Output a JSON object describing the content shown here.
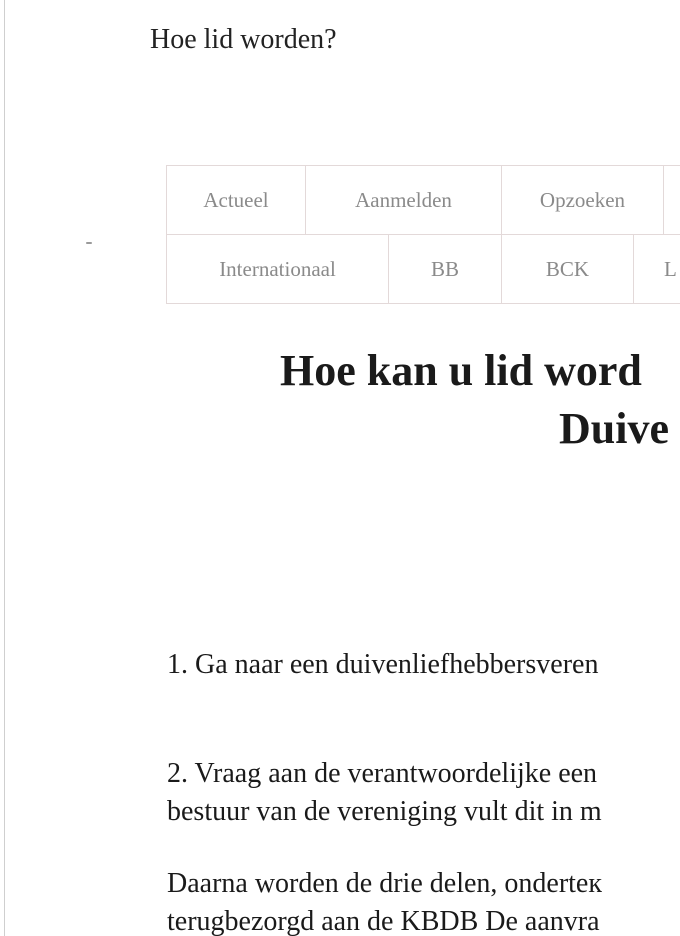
{
  "header": {
    "title": "Hoe lid worden?"
  },
  "nav": {
    "row1": [
      "Actueel",
      "Aanmelden",
      "Opzoeken",
      ""
    ],
    "row2": [
      "Internationaal",
      "BB",
      "BCK",
      "L"
    ]
  },
  "main": {
    "title_line1": "Hoe kan u lid word",
    "title_line2": "Duive",
    "step1": "1. Ga naar een duivenliefhebbersveren",
    "step2_line1": "2. Vraag aan de verantwoordelijke een",
    "step2_line2": "bestuur van de vereniging vult dit in m",
    "para3_line1": "Daarna worden de drie delen, onderteк",
    "para3_line2": "terugbezorgd aan de KBDB De aanvra"
  }
}
